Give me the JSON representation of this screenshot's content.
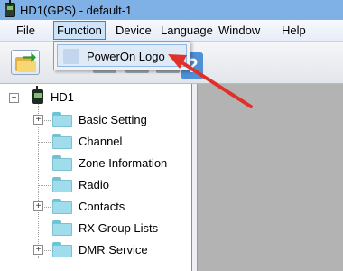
{
  "window": {
    "title": "HD1(GPS)  -  default-1"
  },
  "menubar": {
    "items": [
      {
        "label": "File"
      },
      {
        "label": "Function"
      },
      {
        "label": "Device"
      },
      {
        "label": "Language"
      },
      {
        "label": "Window"
      },
      {
        "label": "Help"
      }
    ],
    "active_item": "Function"
  },
  "dropdown": {
    "items": [
      {
        "label": "PowerOn Logo"
      }
    ]
  },
  "toolbar": {
    "help_glyph": "?"
  },
  "tree": {
    "root": {
      "label": "HD1",
      "expander": "−"
    },
    "nodes": [
      {
        "label": "Basic Setting",
        "expander": "+"
      },
      {
        "label": "Channel"
      },
      {
        "label": "Zone Information"
      },
      {
        "label": "Radio"
      },
      {
        "label": "Contacts",
        "expander": "+"
      },
      {
        "label": "RX Group Lists"
      },
      {
        "label": "DMR Service",
        "expander": "+"
      }
    ]
  },
  "annotation": {
    "arrow_color": "#e0302a"
  }
}
